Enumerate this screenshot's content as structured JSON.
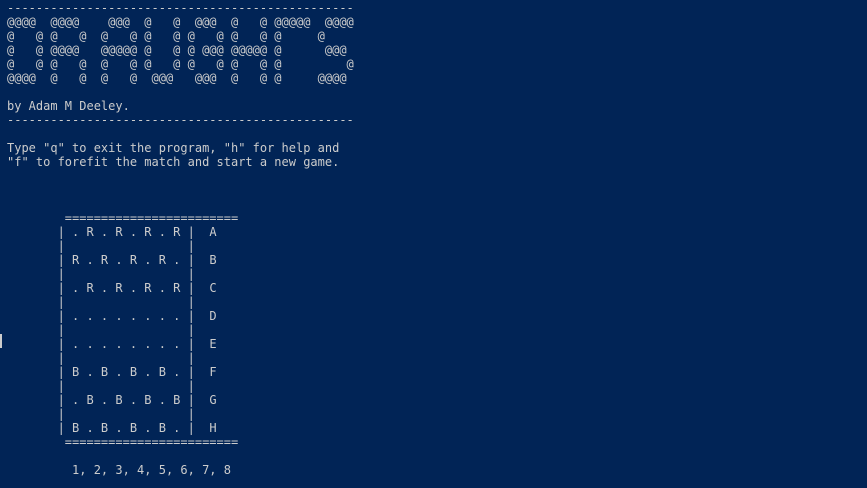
{
  "terminal": {
    "banner": {
      "rule_top": "------------------------------------------------",
      "art": [
        "@@@@  @@@@    @@@  @   @  @@@  @   @ @@@@@  @@@@",
        "@   @ @   @  @   @ @   @ @   @ @   @ @     @",
        "@   @ @@@@   @@@@@ @   @ @ @@@ @@@@@ @      @@@",
        "@   @ @   @  @   @ @   @ @   @ @   @ @         @",
        "@@@@  @   @  @   @  @@@   @@@  @   @ @     @@@@"
      ],
      "author": "by Adam M Deeley.",
      "rule_bottom": "------------------------------------------------"
    },
    "instructions": [
      "Type \"q\" to exit the program, \"h\" for help and",
      "\"f\" to forefit the match and start a new game."
    ],
    "board": {
      "border_top": "========================",
      "border_bottom": "========================",
      "rows": [
        {
          "cells": ". R . R . R . R",
          "label": "A"
        },
        {
          "cells": "R . R . R . R .",
          "label": "B"
        },
        {
          "cells": ". R . R . R . R",
          "label": "C"
        },
        {
          "cells": ". . . . . . . .",
          "label": "D"
        },
        {
          "cells": ". . . . . . . .",
          "label": "E"
        },
        {
          "cells": "B . B . B . B .",
          "label": "F"
        },
        {
          "cells": ". B . B . B . B",
          "label": "G"
        },
        {
          "cells": "B . B . B . B .",
          "label": "H"
        }
      ],
      "column_numbers": "1, 2, 3, 4, 5, 6, 7, 8"
    }
  },
  "colors": {
    "background": "#012456",
    "foreground": "#CCCCCC"
  }
}
